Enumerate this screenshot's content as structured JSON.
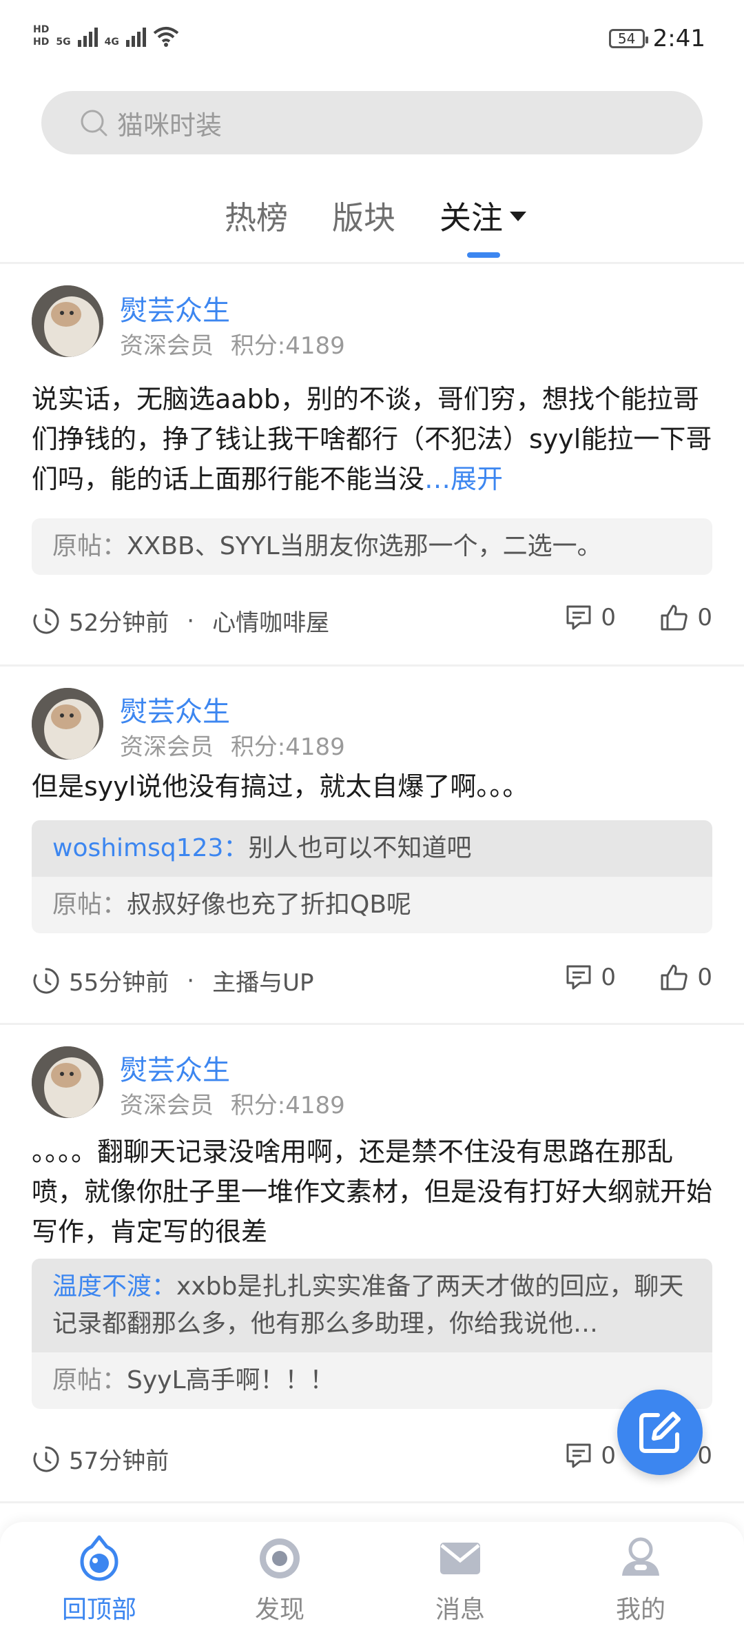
{
  "status_bar": {
    "hd1": "HD",
    "hd2": "HD",
    "net1": "5G",
    "net2": "4G",
    "battery": "54",
    "time": "2:41"
  },
  "search": {
    "placeholder": "猫咪时装"
  },
  "tabs": [
    {
      "label": "热榜"
    },
    {
      "label": "版块"
    },
    {
      "label": "关注"
    }
  ],
  "posts": [
    {
      "username": "熨芸众生",
      "rank": "资深会员",
      "points": "积分:4189",
      "text": "说实话，无脑选aabb，别的不谈，哥们穷，想找个能拉哥们挣钱的，挣了钱让我干啥都行（不犯法）syyl能拉一下哥们吗，能的话上面那行能不能当没",
      "expand": "…展开",
      "original_label": "原帖：",
      "original": "XXBB、SYYL当朋友你选那一个，二选一。",
      "time": "52分钟前",
      "board": "心情咖啡屋",
      "comments": "0",
      "likes": "0"
    },
    {
      "username": "熨芸众生",
      "rank": "资深会员",
      "points": "积分:4189",
      "text": "但是syyl说他没有搞过，就太自爆了啊。。。",
      "reply_user": "woshimsq123：",
      "reply_text": "别人也可以不知道吧",
      "original_label": "原帖：",
      "original": "叔叔好像也充了折扣QB呢",
      "time": "55分钟前",
      "board": "主播与UP",
      "comments": "0",
      "likes": "0"
    },
    {
      "username": "熨芸众生",
      "rank": "资深会员",
      "points": "积分:4189",
      "text": "。。。。翻聊天记录没啥用啊，还是禁不住没有思路在那乱喷，就像你肚子里一堆作文素材，但是没有打好大纲就开始写作，肯定写的很差",
      "reply_user": "温度不渡：",
      "reply_text": "xxbb是扎扎实实准备了两天才做的回应，聊天记录都翻那么多，他有那么多助理，你给我说他…",
      "original_label": "原帖：",
      "original": "SyyL高手啊！！！",
      "time": "57分钟前",
      "comments": "0",
      "likes": "0"
    }
  ],
  "bottom_nav": [
    {
      "label": "回顶部"
    },
    {
      "label": "发现"
    },
    {
      "label": "消息"
    },
    {
      "label": "我的"
    }
  ],
  "colors": {
    "accent": "#3c86f0",
    "bg": "#ffffff",
    "quote_bg": "#f3f3f3",
    "reply_bg": "#e6e6e6"
  }
}
